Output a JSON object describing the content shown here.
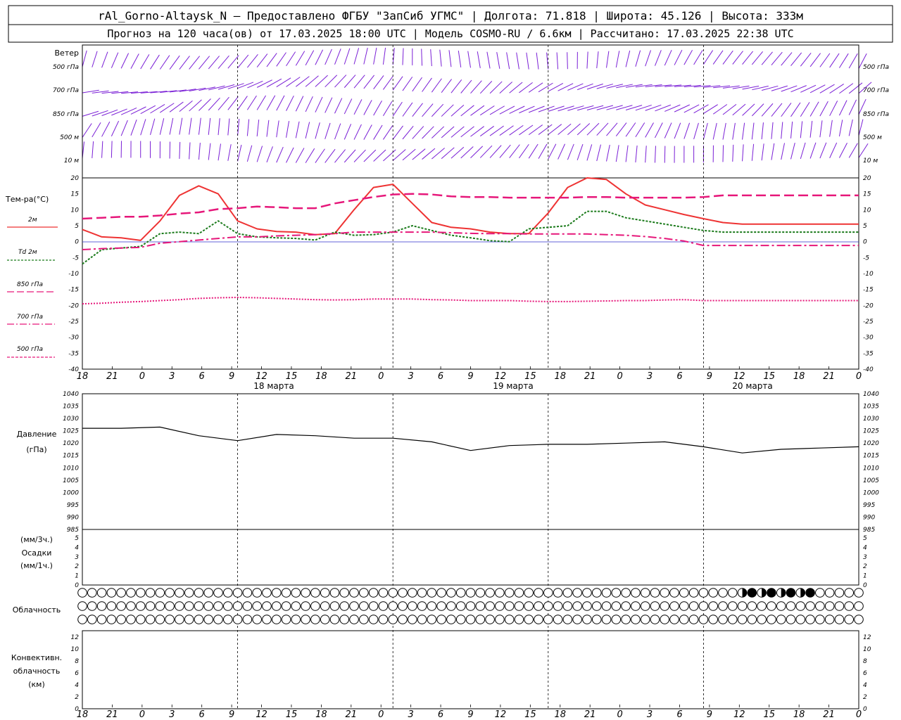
{
  "header": {
    "line1": "rAl_Gorno-Altaysk_N – Предоставлено ФГБУ \"ЗапСиб УГМС\" | Долгота: 71.818 | Широта: 45.126 | Высота: 333м",
    "line2": "Прогноз на 120 часа(ов) от 17.03.2025 18:00 UTC  | Модель COSMO-RU / 6.6км | Рассчитано: 17.03.2025 22:38 UTC"
  },
  "wind_panel": {
    "title": "Ветер",
    "levels": [
      "500 гПа",
      "700 гПа",
      "850 гПа",
      "500 м",
      "10  м"
    ],
    "colors": {
      "barb": "#7a1fd6"
    }
  },
  "temp_panel": {
    "ylabel": "Тем-ра(°C)",
    "legend": [
      {
        "label": "2м",
        "color": "#ee3333",
        "style": "solid"
      },
      {
        "label": "Td  2м",
        "color": "#1a7a1a",
        "style": "dotted"
      },
      {
        "label": "850 гПа",
        "color": "#e6177a",
        "style": "long-dash"
      },
      {
        "label": "700 гПа",
        "color": "#e6177a",
        "style": "dash-dot"
      },
      {
        "label": "500 гПа",
        "color": "#e6177a",
        "style": "short-dash"
      }
    ],
    "yticks": [
      "20",
      "15",
      "10",
      "5",
      "0",
      "-5",
      "-10",
      "-15",
      "-20",
      "-25",
      "-30",
      "-35",
      "-40"
    ],
    "ylim": [
      -40,
      20
    ]
  },
  "x_axis": {
    "tick_labels": [
      "18",
      "21",
      "0",
      "3",
      "6",
      "9",
      "12",
      "15",
      "18",
      "21",
      "0",
      "3",
      "6",
      "9",
      "12",
      "15",
      "18",
      "21",
      "0",
      "3",
      "6",
      "9",
      "12",
      "15",
      "18",
      "21",
      "0"
    ],
    "days": [
      "18 марта",
      "19 марта",
      "20 марта"
    ]
  },
  "pressure_panel": {
    "ylabel1": "Давление",
    "ylabel2": "(гПа)",
    "yticks": [
      "1040",
      "1035",
      "1030",
      "1025",
      "1020",
      "1015",
      "1010",
      "1005",
      "1000",
      "995",
      "990",
      "985"
    ],
    "ylim": [
      985,
      1040
    ]
  },
  "precip_panel": {
    "label1": "(мм/3ч.)",
    "label2": "Осадки",
    "label3": "(мм/1ч.)",
    "yticks": [
      "5",
      "4",
      "3",
      "2",
      "1",
      "0"
    ]
  },
  "cloud_panel": {
    "label": "Облачность"
  },
  "conv_panel": {
    "label1": "Конвективн.",
    "label2": "облачность",
    "label3": "(км)",
    "yticks": [
      "12",
      "10",
      "8",
      "6",
      "4",
      "2",
      "0"
    ]
  },
  "chart_data": {
    "type": "line",
    "x_hours": [
      0,
      3,
      6,
      9,
      12,
      15,
      18,
      21,
      24,
      27,
      30,
      33,
      36,
      39,
      42,
      45,
      48,
      51,
      54,
      57,
      60,
      63,
      66,
      69,
      72,
      75,
      78
    ],
    "series": [
      {
        "name": "2м",
        "values": [
          3.8,
          1.5,
          1.2,
          0.4,
          6.5,
          14.5,
          17.5,
          15,
          6.5,
          4,
          3.2,
          3,
          2.2,
          2.5,
          10,
          17,
          18,
          12,
          6,
          4.5,
          4,
          3,
          2.5,
          2.5,
          9,
          17,
          20
        ]
      },
      {
        "name": "Td 2м",
        "values": [
          -7,
          -2.5,
          -2,
          -1.5,
          2.5,
          3,
          2.5,
          6.5,
          2.5,
          1.5,
          1.2,
          1,
          0.5,
          3,
          2,
          2.2,
          3,
          5,
          3.5,
          2,
          1.2,
          0.3,
          0,
          4,
          4.5,
          5,
          9.5
        ]
      },
      {
        "name": "850 гПа",
        "values": [
          7.2,
          7.5,
          7.8,
          7.8,
          8.2,
          8.8,
          9.2,
          10.2,
          10.5,
          11,
          10.8,
          10.5,
          10.5,
          12,
          13,
          14,
          14.8,
          15,
          14.8,
          14.2,
          14,
          14,
          13.8,
          13.8,
          13.8,
          13.8,
          14
        ]
      },
      {
        "name": "700 гПа",
        "values": [
          -2.5,
          -2.2,
          -2,
          -1.8,
          -0.5,
          0,
          0.5,
          1,
          1.5,
          1.5,
          1.8,
          2,
          2.2,
          2.5,
          3,
          3,
          3,
          3,
          3,
          2.8,
          2.6,
          2.5,
          2.5,
          2.4,
          2.4,
          2.4,
          2.4
        ]
      },
      {
        "name": "500 гПа",
        "values": [
          -19.5,
          -19.3,
          -19,
          -18.8,
          -18.5,
          -18.2,
          -17.8,
          -17.6,
          -17.5,
          -17.6,
          -17.8,
          -18,
          -18.2,
          -18.3,
          -18.2,
          -18,
          -18,
          -18,
          -18.2,
          -18.3,
          -18.5,
          -18.5,
          -18.5,
          -18.7,
          -18.8,
          -18.8,
          -18.7
        ]
      }
    ],
    "x_tail": [
      81,
      84,
      87,
      90,
      93,
      96,
      99,
      102,
      105,
      108,
      111,
      114,
      117,
      120
    ],
    "tails": {
      "2м": [
        19.5,
        15,
        11.5,
        10,
        8.5,
        7.2,
        6,
        5.5,
        5.5,
        5.5,
        5.5,
        5.5,
        5.5,
        5.5
      ],
      "Td 2м": [
        9.5,
        7.5,
        6.5,
        5.5,
        4.5,
        3.5,
        3,
        3,
        3,
        3,
        3,
        3,
        3,
        3
      ],
      "850 гПа": [
        14,
        13.8,
        13.8,
        13.8,
        13.8,
        14,
        14.5,
        14.5,
        14.5,
        14.5,
        14.5,
        14.5,
        14.5,
        14.5
      ],
      "700 гПа": [
        2.2,
        2,
        1.6,
        1,
        0.2,
        -1.2,
        -1.2,
        -1.2,
        -1.2,
        -1.2,
        -1.2,
        -1.2,
        -1.2,
        -1.2
      ],
      "500 гПа": [
        -18.6,
        -18.5,
        -18.5,
        -18.3,
        -18.2,
        -18.5,
        -18.5,
        -18.5,
        -18.5,
        -18.5,
        -18.5,
        -18.5,
        -18.5,
        -18.5
      ]
    },
    "pressure": {
      "x_hours": [
        0,
        6,
        12,
        18,
        24,
        30,
        36,
        42,
        48,
        54,
        60,
        66,
        72,
        78,
        84,
        90,
        96,
        102,
        108,
        114,
        120
      ],
      "values": [
        1026,
        1026,
        1026.5,
        1023,
        1021,
        1023.5,
        1023,
        1022,
        1022,
        1020.5,
        1017,
        1019,
        1019.5,
        1019.5,
        1020,
        1020.5,
        1018.5,
        1016,
        1017.5,
        1018,
        1018.5
      ]
    },
    "xlim": [
      0,
      120
    ]
  }
}
